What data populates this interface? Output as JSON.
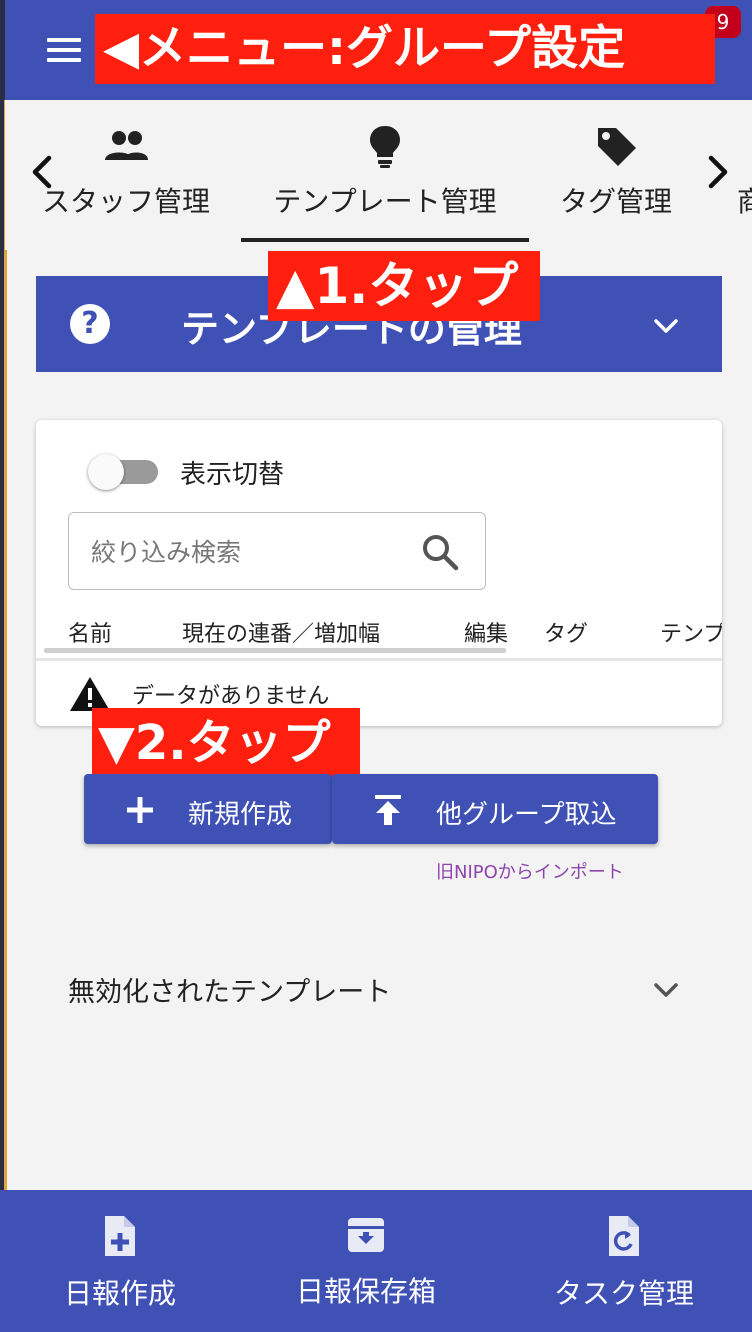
{
  "header": {
    "notification_count": "9",
    "menu_banner": "◀メニュー:グループ設定"
  },
  "tabs": {
    "items": [
      {
        "label": "スタッフ管理",
        "icon": "people-icon"
      },
      {
        "label": "テンプレート管理",
        "icon": "lightbulb-icon"
      },
      {
        "label": "タグ管理",
        "icon": "tag-icon"
      },
      {
        "label": "商",
        "icon": ""
      }
    ],
    "active_index": 1
  },
  "annotations": {
    "step1": "▲1.タップ",
    "step2": "▼2.タップ"
  },
  "section": {
    "title": "テンプレートの管理",
    "help_symbol": "?"
  },
  "card": {
    "toggle_label": "表示切替",
    "toggle_on": false,
    "search_placeholder": "絞り込み検索",
    "search_value": "",
    "columns": [
      "名前",
      "現在の連番／増加幅",
      "編集",
      "タグ",
      "テンプ"
    ],
    "empty_message": "データがありません"
  },
  "actions": {
    "new_label": "新規作成",
    "import_label": "他グループ取込",
    "legacy_import_label": "旧NIPOからインポート"
  },
  "disabled_section": {
    "label": "無効化されたテンプレート"
  },
  "bottom_nav": {
    "items": [
      {
        "label": "日報作成",
        "icon": "file-add-icon"
      },
      {
        "label": "日報保存箱",
        "icon": "archive-icon"
      },
      {
        "label": "タスク管理",
        "icon": "file-refresh-icon"
      }
    ]
  },
  "colors": {
    "primary": "#3f51b5",
    "annotation_red": "#ff1f0f",
    "badge_red": "#c2001b",
    "link_purple": "#8e44ad",
    "background": "#f3f3f3"
  }
}
